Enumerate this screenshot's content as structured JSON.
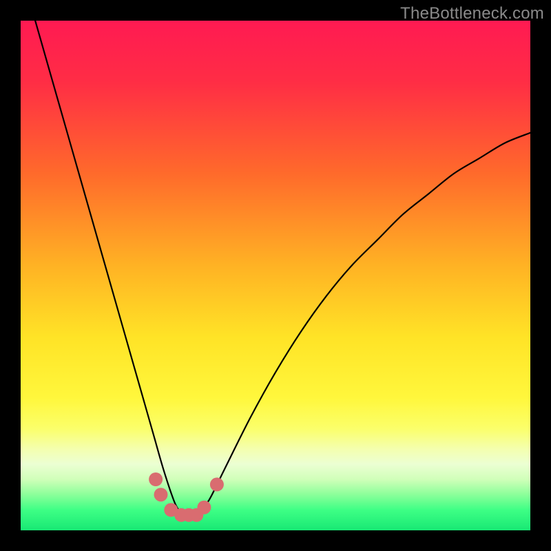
{
  "watermark": "TheBottleneck.com",
  "colors": {
    "black": "#000000",
    "curve": "#000000",
    "marker": "#d96c70"
  },
  "chart_data": {
    "type": "line",
    "title": "",
    "xlabel": "",
    "ylabel": "",
    "xlim": [
      0,
      100
    ],
    "ylim": [
      0,
      100
    ],
    "series": [
      {
        "name": "bottleneck-curve",
        "x": [
          0,
          2,
          4,
          6,
          8,
          10,
          12,
          14,
          16,
          18,
          20,
          22,
          24,
          26,
          28,
          30,
          31,
          32,
          33,
          34,
          35,
          37,
          40,
          45,
          50,
          55,
          60,
          65,
          70,
          75,
          80,
          85,
          90,
          95,
          100
        ],
        "y": [
          110,
          103,
          96,
          89,
          82,
          75,
          68,
          61,
          54,
          47,
          40,
          33,
          26,
          19,
          12,
          6,
          4,
          3,
          3,
          3,
          3.5,
          6,
          12,
          22,
          31,
          39,
          46,
          52,
          57,
          62,
          66,
          70,
          73,
          76,
          78
        ]
      }
    ],
    "markers": [
      {
        "x": 26.5,
        "y": 10
      },
      {
        "x": 27.5,
        "y": 7
      },
      {
        "x": 29.5,
        "y": 4
      },
      {
        "x": 31.5,
        "y": 3
      },
      {
        "x": 33.0,
        "y": 3
      },
      {
        "x": 34.5,
        "y": 3
      },
      {
        "x": 36.0,
        "y": 4.5
      },
      {
        "x": 38.5,
        "y": 9
      }
    ],
    "gradient_stops": [
      {
        "pct": 0,
        "color": "#ff1a52"
      },
      {
        "pct": 12,
        "color": "#ff2d45"
      },
      {
        "pct": 30,
        "color": "#ff6a2b"
      },
      {
        "pct": 48,
        "color": "#ffb224"
      },
      {
        "pct": 62,
        "color": "#ffe326"
      },
      {
        "pct": 74,
        "color": "#fff73c"
      },
      {
        "pct": 80,
        "color": "#fbff6a"
      },
      {
        "pct": 84,
        "color": "#f4ffae"
      },
      {
        "pct": 87,
        "color": "#ecffd3"
      },
      {
        "pct": 90,
        "color": "#d0ffb9"
      },
      {
        "pct": 93,
        "color": "#8bff9a"
      },
      {
        "pct": 96,
        "color": "#3eff85"
      },
      {
        "pct": 100,
        "color": "#18e874"
      }
    ]
  }
}
